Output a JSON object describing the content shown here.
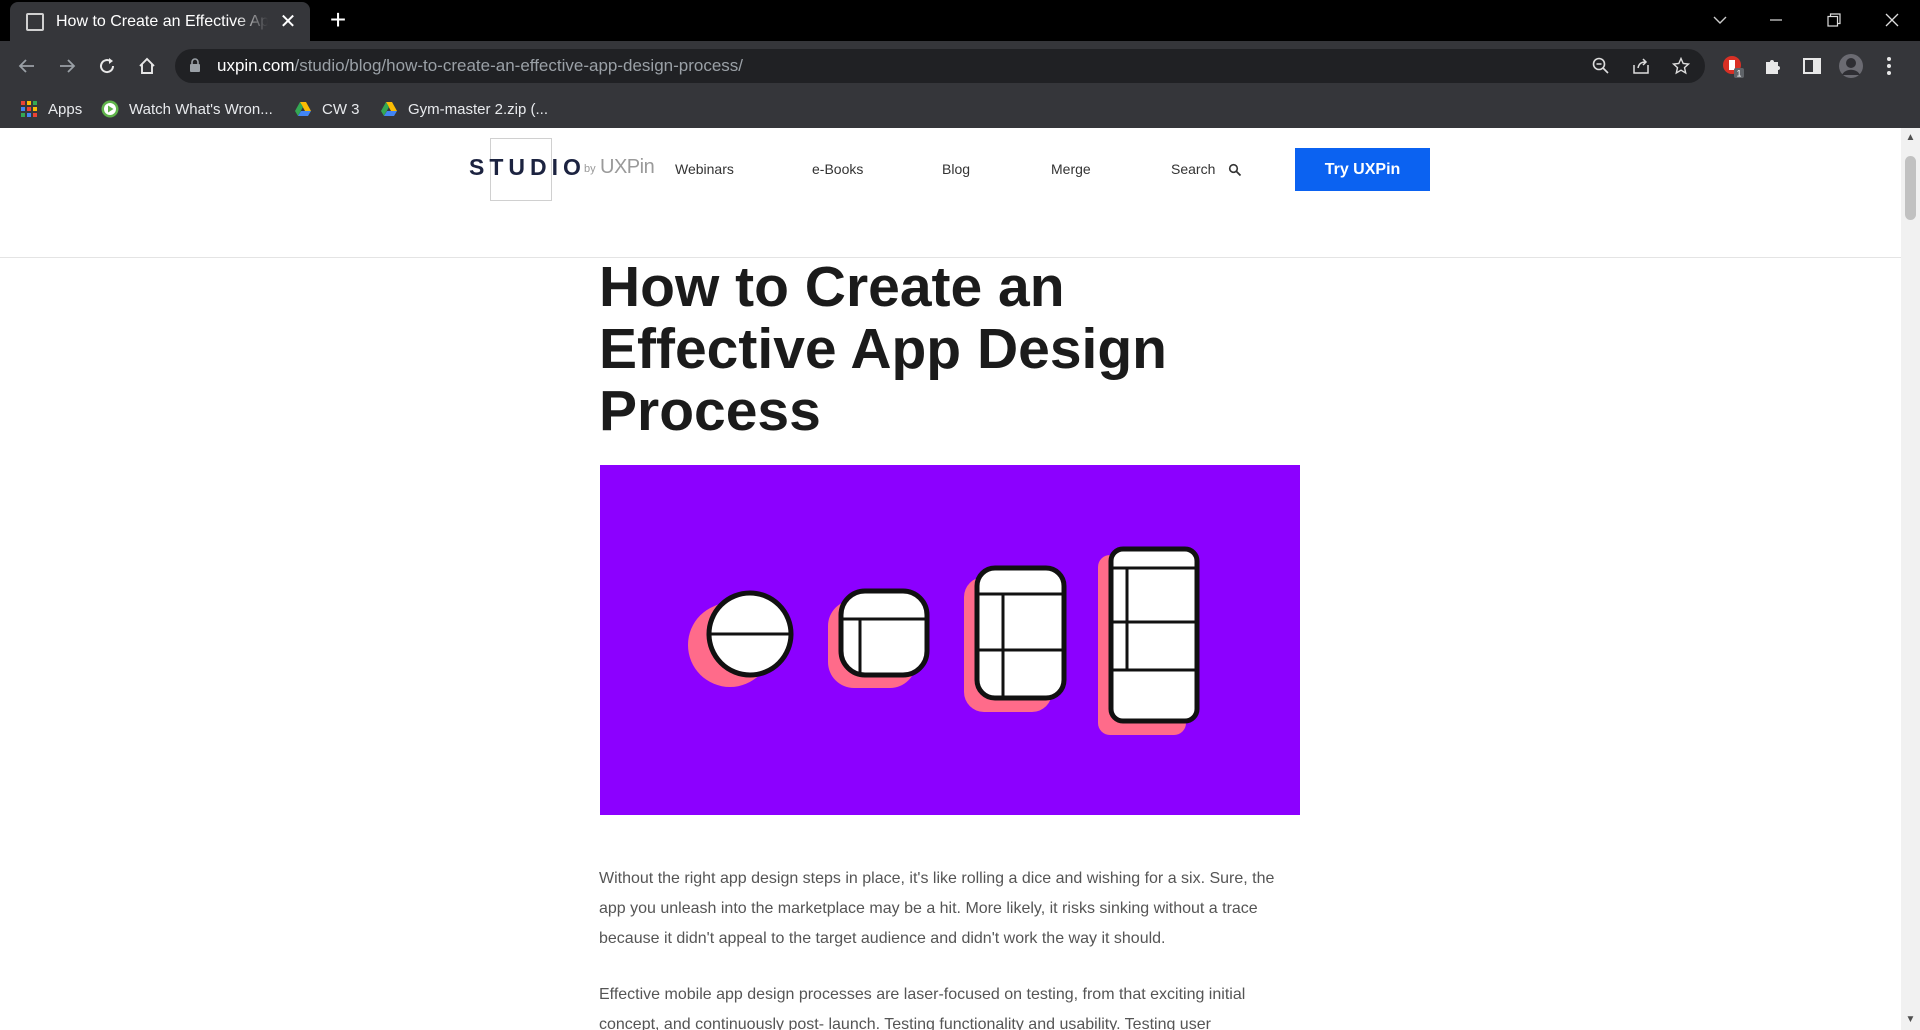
{
  "browser": {
    "tab_title": "How to Create an Effective App Design Process",
    "url_host": "uxpin.com",
    "url_path": "/studio/blog/how-to-create-an-effective-app-design-process/",
    "extension_badge": "1",
    "bookmarks": [
      {
        "label": "Apps",
        "icon": "apps-grid-icon"
      },
      {
        "label": "Watch What's Wron...",
        "icon": "play-circle-icon"
      },
      {
        "label": "CW 3",
        "icon": "google-drive-icon"
      },
      {
        "label": "Gym-master 2.zip (...",
        "icon": "google-drive-icon"
      }
    ]
  },
  "site": {
    "logo_text": "STUDIO",
    "logo_by": "by",
    "logo_brand": "UXPin",
    "nav": [
      "Webinars",
      "e-Books",
      "Blog",
      "Merge"
    ],
    "search_label": "Search",
    "cta_label": "Try UXPin",
    "accent_color": "#0b62f1"
  },
  "article": {
    "title": "How to Create an Effective App Design Process",
    "hero_color": "#8c00ff",
    "hero_shadow_color": "#ff6b8a",
    "paragraphs": [
      "Without the right app design steps in place, it's like rolling a dice and wishing for a six. Sure, the app you unleash into the marketplace may be a hit. More likely, it risks sinking without a trace because it didn't appeal to the target audience and didn't work the way it should.",
      "Effective mobile app design processes are laser-focused on testing, from that exciting initial concept, and continuously post- launch. Testing functionality and usability. Testing user"
    ]
  }
}
